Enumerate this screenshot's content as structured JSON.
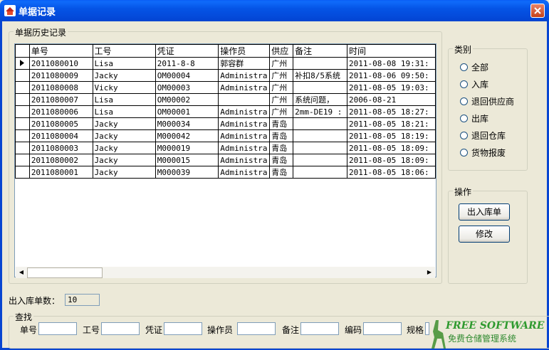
{
  "window": {
    "title": "单据记录"
  },
  "history_group": {
    "title": "单据历史记录"
  },
  "table": {
    "columns": [
      "单号",
      "工号",
      "凭证",
      "操作员",
      "供应",
      "备注",
      "时间"
    ],
    "rows": [
      [
        "2011080010",
        "Lisa",
        "2011-8-8",
        "郭容群",
        "广州",
        "",
        "2011-08-08 19:31:"
      ],
      [
        "2011080009",
        "Jacky",
        "OM00004",
        "Administra",
        "广州",
        "补扣8/5系统",
        "2011-08-06 09:50:"
      ],
      [
        "2011080008",
        "Vicky",
        "OM00003",
        "Administra",
        "广州",
        "",
        "2011-08-05 19:03:"
      ],
      [
        "2011080007",
        "Lisa",
        "OM00002",
        "",
        "广州",
        "系统问题，",
        "2006-08-21"
      ],
      [
        "2011080006",
        "Lisa",
        "OM00001",
        "Administra",
        "广州",
        " 2mm-DE19 :",
        "2011-08-05 18:27:"
      ],
      [
        "2011080005",
        "Jacky",
        "M000034",
        "Administra",
        "青岛",
        "",
        "2011-08-05 18:21:"
      ],
      [
        "2011080004",
        "Jacky",
        "M000042",
        "Administra",
        "青岛",
        "",
        "2011-08-05 18:19:"
      ],
      [
        "2011080003",
        "Jacky",
        "M000019",
        "Administra",
        "青岛",
        "",
        "2011-08-05 18:09:"
      ],
      [
        "2011080002",
        "Jacky",
        "M000015",
        "Administra",
        "青岛",
        "",
        "2011-08-05 18:09:"
      ],
      [
        "2011080001",
        "Jacky",
        "M000039",
        "Administra",
        "青岛",
        "",
        "2011-08-05 18:06:"
      ]
    ]
  },
  "category": {
    "title": "类别",
    "options": [
      "全部",
      "入库",
      "退回供应商",
      "出库",
      "退回仓库",
      "货物报废"
    ]
  },
  "actions": {
    "title": "操作",
    "io_button": "出入库单",
    "edit_button": "修改"
  },
  "count": {
    "label": "出入库单数：",
    "value": "10"
  },
  "search": {
    "title": "查找",
    "fields": [
      "单号",
      "工号",
      "凭证",
      "操作员",
      "备注",
      "编码",
      "规格"
    ]
  },
  "watermark": {
    "brand": "FREE SOFTWARE",
    "subtitle": "免费仓储管理系统"
  },
  "colors": {
    "titlebar": "#0554E6",
    "window_bg": "#ECE9D8",
    "close": "#C4411A",
    "watermark": "#2F9A2F"
  }
}
